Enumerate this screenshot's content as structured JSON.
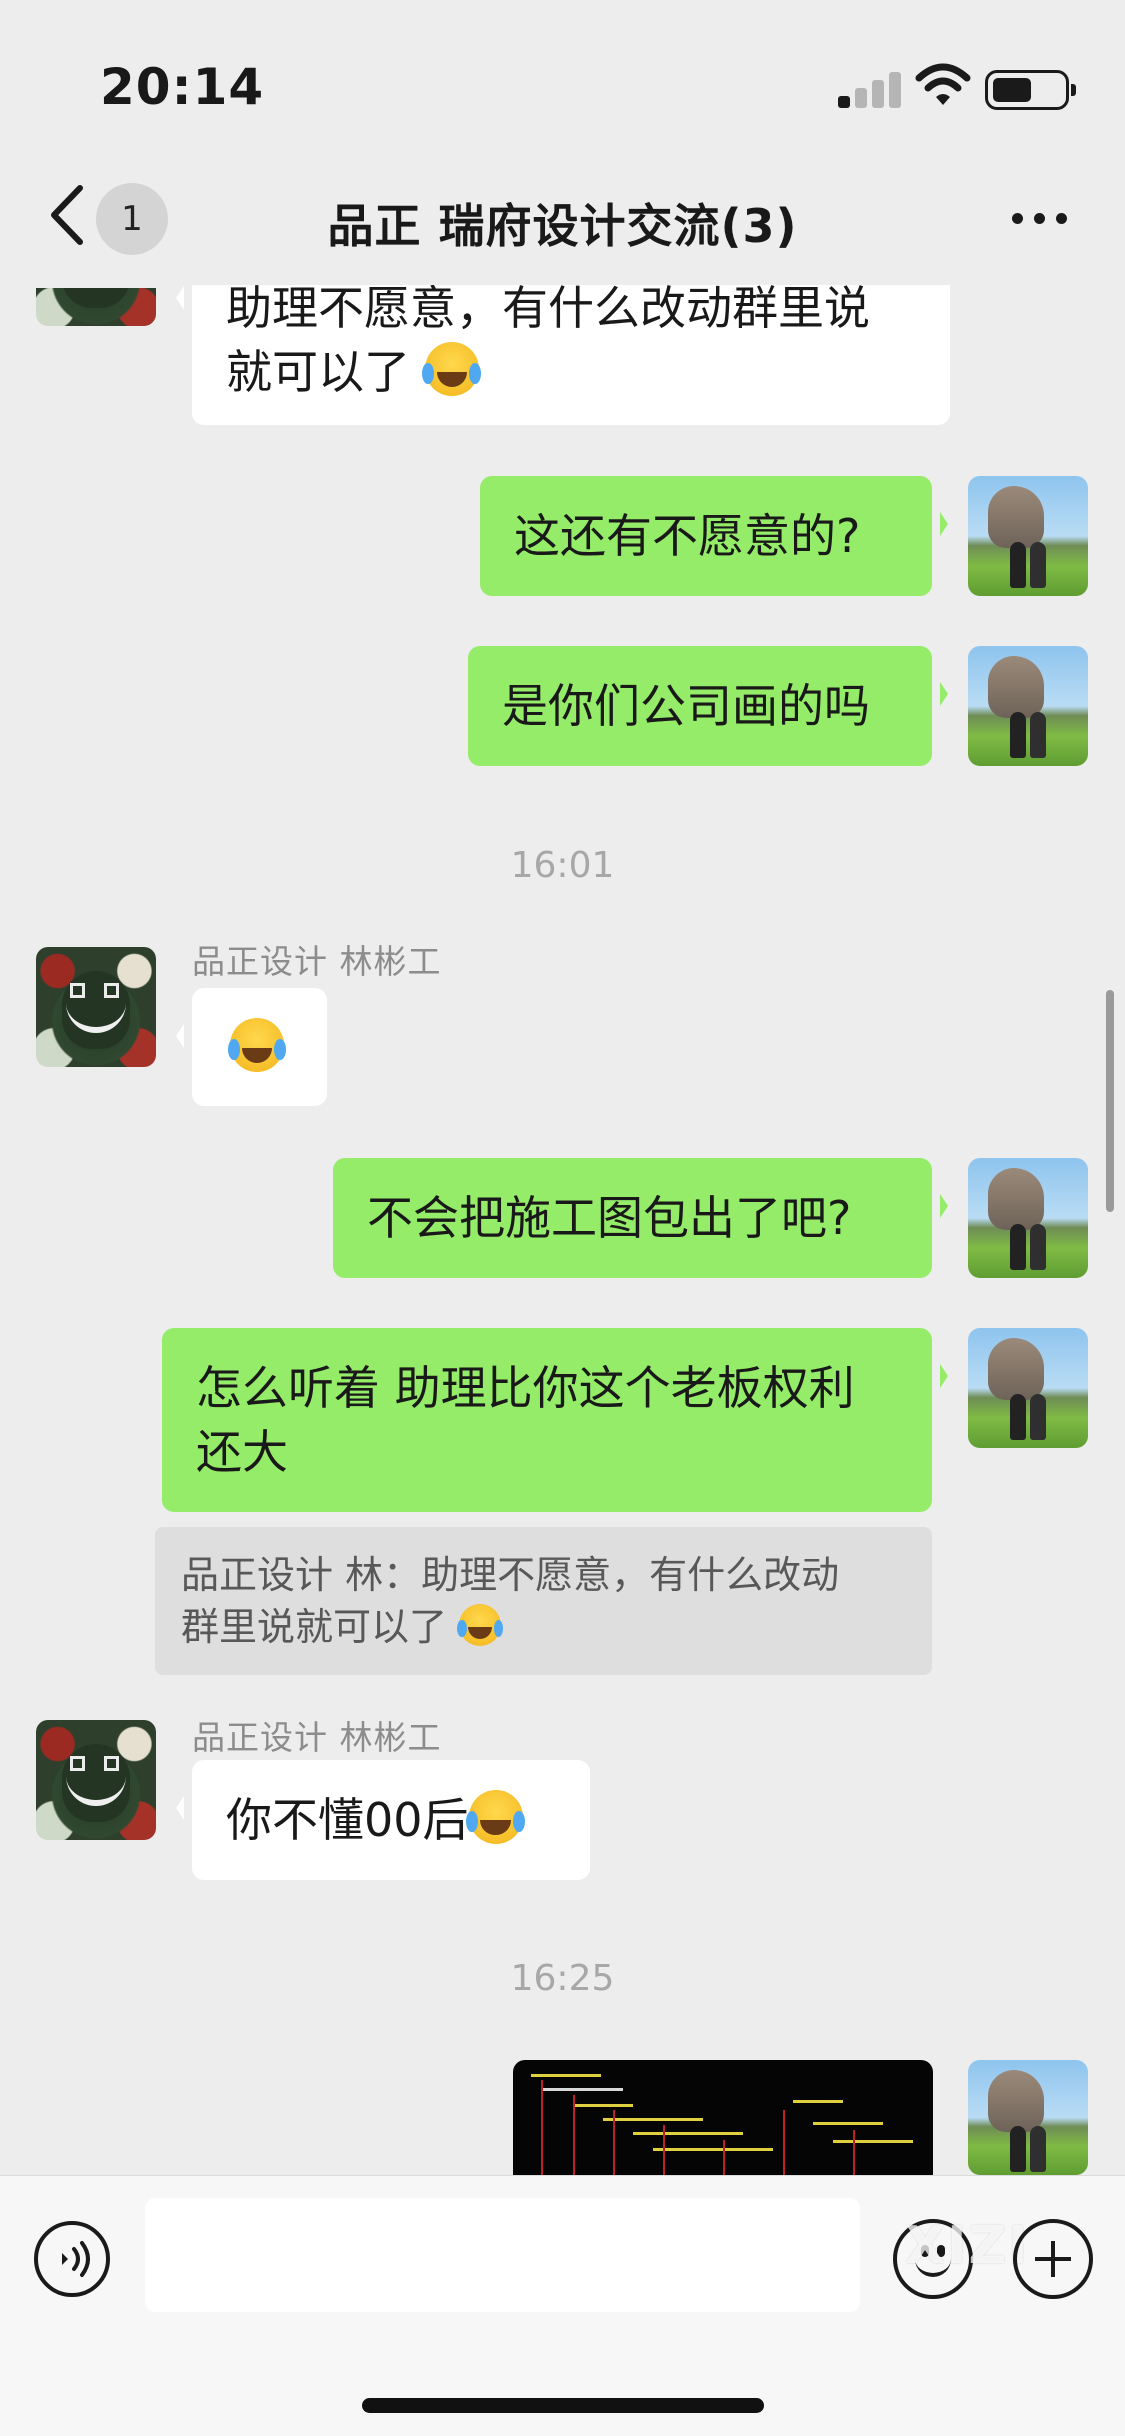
{
  "status_bar": {
    "time": "20:14"
  },
  "header": {
    "title": "品正 瑞府设计交流(3)",
    "unread_count": "1"
  },
  "messages": {
    "m1_text_line1": "助理不愿意，有什么改动群里说",
    "m1_text_line2": "就可以了",
    "m2_text": "这还有不愿意的?",
    "m3_text": "是你们公司画的吗",
    "time1": "16:01",
    "m4_sender": "品正设计  林彬工",
    "m5_text": "不会把施工图包出了吧?",
    "m6_text_line1": "怎么听着 助理比你这个老板权利",
    "m6_text_line2": "还大",
    "quote_line1": "品正设计  林：助理不愿意，有什么改动",
    "quote_line2": "群里说就可以了",
    "m7_sender": "品正设计  林彬工",
    "m7_text": "你不懂00后",
    "time2": "16:25"
  },
  "input_bar": {
    "value": "",
    "watermark": "XIZI"
  },
  "icons": {
    "back": "chevron-left-icon",
    "more": "more-dots-icon",
    "voice": "voice-icon",
    "emoji": "emoji-icon",
    "plus": "plus-icon",
    "face_emoji": "tears-of-joy-emoji"
  },
  "colors": {
    "out_bubble": "#95ec69",
    "in_bubble": "#ffffff",
    "background": "#ededed"
  }
}
